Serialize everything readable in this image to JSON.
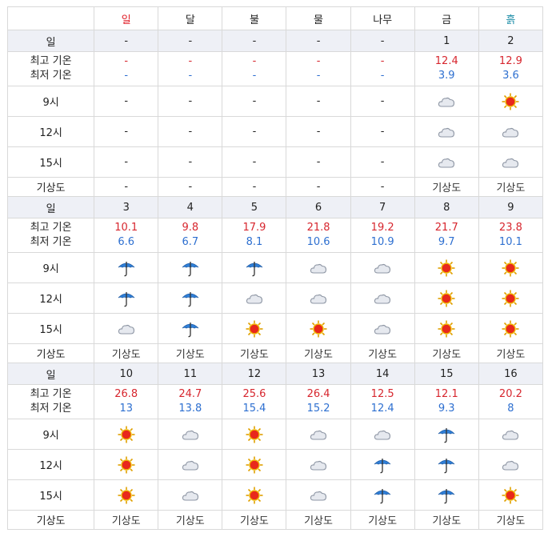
{
  "weekday_header": [
    "일",
    "달",
    "불",
    "물",
    "나무",
    "금",
    "흙"
  ],
  "labels": {
    "date": "일",
    "high": "최고 기온",
    "low": "최저 기온",
    "t9": "9시",
    "t12": "12시",
    "t15": "15시",
    "map": "기상도"
  },
  "colors": {
    "sunday": "#e0202a",
    "saturday": "#1f8ea8",
    "high_temp": "#d7262e",
    "low_temp": "#2d6fd0"
  },
  "weeks": [
    {
      "days": [
        {
          "date": "-",
          "high": "-",
          "low": "-",
          "t9": null,
          "t12": null,
          "t15": null,
          "map": "-"
        },
        {
          "date": "-",
          "high": "-",
          "low": "-",
          "t9": null,
          "t12": null,
          "t15": null,
          "map": "-"
        },
        {
          "date": "-",
          "high": "-",
          "low": "-",
          "t9": null,
          "t12": null,
          "t15": null,
          "map": "-"
        },
        {
          "date": "-",
          "high": "-",
          "low": "-",
          "t9": null,
          "t12": null,
          "t15": null,
          "map": "-"
        },
        {
          "date": "-",
          "high": "-",
          "low": "-",
          "t9": null,
          "t12": null,
          "t15": null,
          "map": "-"
        },
        {
          "date": "1",
          "high": "12.4",
          "low": "3.9",
          "t9": "cloud",
          "t12": "cloud",
          "t15": "cloud",
          "map": "기상도"
        },
        {
          "date": "2",
          "high": "12.9",
          "low": "3.6",
          "t9": "sun",
          "t12": "cloud",
          "t15": "cloud",
          "map": "기상도"
        }
      ]
    },
    {
      "days": [
        {
          "date": "3",
          "high": "10.1",
          "low": "6.6",
          "t9": "umbrella",
          "t12": "umbrella",
          "t15": "cloud",
          "map": "기상도"
        },
        {
          "date": "4",
          "high": "9.8",
          "low": "6.7",
          "t9": "umbrella",
          "t12": "umbrella",
          "t15": "umbrella",
          "map": "기상도"
        },
        {
          "date": "5",
          "high": "17.9",
          "low": "8.1",
          "t9": "umbrella",
          "t12": "cloud",
          "t15": "sun",
          "map": "기상도"
        },
        {
          "date": "6",
          "high": "21.8",
          "low": "10.6",
          "t9": "cloud",
          "t12": "cloud",
          "t15": "sun",
          "map": "기상도"
        },
        {
          "date": "7",
          "high": "19.2",
          "low": "10.9",
          "t9": "cloud",
          "t12": "cloud",
          "t15": "cloud",
          "map": "기상도"
        },
        {
          "date": "8",
          "high": "21.7",
          "low": "9.7",
          "t9": "sun",
          "t12": "sun",
          "t15": "sun",
          "map": "기상도"
        },
        {
          "date": "9",
          "high": "23.8",
          "low": "10.1",
          "t9": "sun",
          "t12": "sun",
          "t15": "sun",
          "map": "기상도"
        }
      ]
    },
    {
      "days": [
        {
          "date": "10",
          "high": "26.8",
          "low": "13",
          "t9": "sun",
          "t12": "sun",
          "t15": "sun",
          "map": "기상도"
        },
        {
          "date": "11",
          "high": "24.7",
          "low": "13.8",
          "t9": "cloud",
          "t12": "cloud",
          "t15": "cloud",
          "map": "기상도"
        },
        {
          "date": "12",
          "high": "25.6",
          "low": "15.4",
          "t9": "sun",
          "t12": "sun",
          "t15": "sun",
          "map": "기상도"
        },
        {
          "date": "13",
          "high": "26.4",
          "low": "15.2",
          "t9": "cloud",
          "t12": "cloud",
          "t15": "cloud",
          "map": "기상도"
        },
        {
          "date": "14",
          "high": "12.5",
          "low": "12.4",
          "t9": "cloud",
          "t12": "umbrella",
          "t15": "umbrella",
          "map": "기상도"
        },
        {
          "date": "15",
          "high": "12.1",
          "low": "9.3",
          "t9": "umbrella",
          "t12": "umbrella",
          "t15": "umbrella",
          "map": "기상도"
        },
        {
          "date": "16",
          "high": "20.2",
          "low": "8",
          "t9": "cloud",
          "t12": "cloud",
          "t15": "sun",
          "map": "기상도"
        }
      ]
    }
  ]
}
